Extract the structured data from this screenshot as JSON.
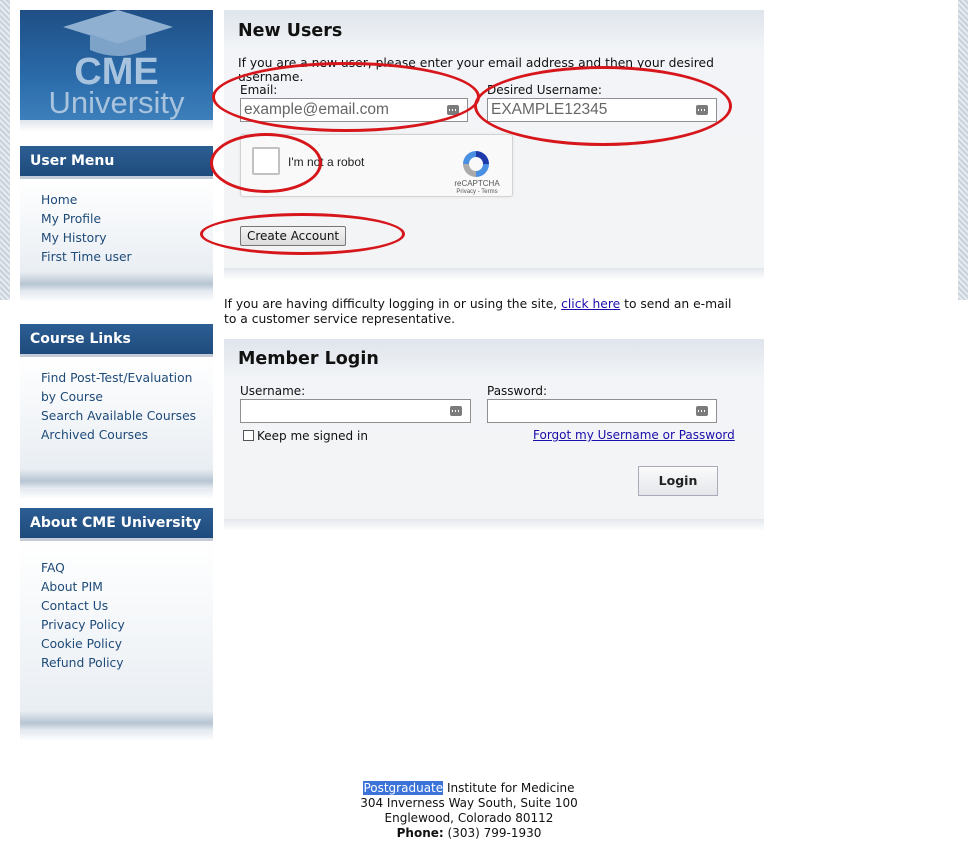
{
  "logo": {
    "line1": "CME",
    "line2": "University"
  },
  "user_menu": {
    "title": "User Menu",
    "items": [
      "Home",
      "My Profile",
      "My History",
      "First Time user"
    ]
  },
  "course_links": {
    "title": "Course Links",
    "items": [
      "Find Post-Test/Evaluation by Course",
      "Search Available Courses",
      "Archived Courses"
    ]
  },
  "about": {
    "title": "About CME University",
    "items": [
      "FAQ",
      "About PIM",
      "Contact Us",
      "Privacy Policy",
      "Cookie Policy",
      "Refund Policy"
    ]
  },
  "new_users": {
    "title": "New Users",
    "intro": "If you are a new user, please enter your email address and then your desired username.",
    "email_label": "Email:",
    "email_value": "example@email.com",
    "username_label": "Desired Username:",
    "username_value": "EXAMPLE12345",
    "captcha_label": "I'm not a robot",
    "captcha_brand": "reCAPTCHA",
    "captcha_terms": "Privacy - Terms",
    "create_button": "Create Account"
  },
  "help": {
    "before": "If you are having difficulty logging in or using the site, ",
    "link": "click here",
    "after": " to send an e-mail to a customer service representative."
  },
  "member_login": {
    "title": "Member Login",
    "username_label": "Username:",
    "password_label": "Password:",
    "keep_signed_in": "Keep me signed in",
    "forgot_link": "Forgot my Username or Password",
    "login_button": "Login"
  },
  "footer": {
    "org_highlight": "Postgraduate",
    "org_rest": " Institute for Medicine",
    "address1": "304 Inverness Way South, Suite 100",
    "address2": "Englewood, Colorado 80112",
    "phone_label": "Phone:",
    "phone_value": " (303) 799-1930"
  },
  "colors": {
    "sidebar_header": "#2c5e94",
    "link": "#1e4a78",
    "annotation_red": "#d6161b"
  }
}
